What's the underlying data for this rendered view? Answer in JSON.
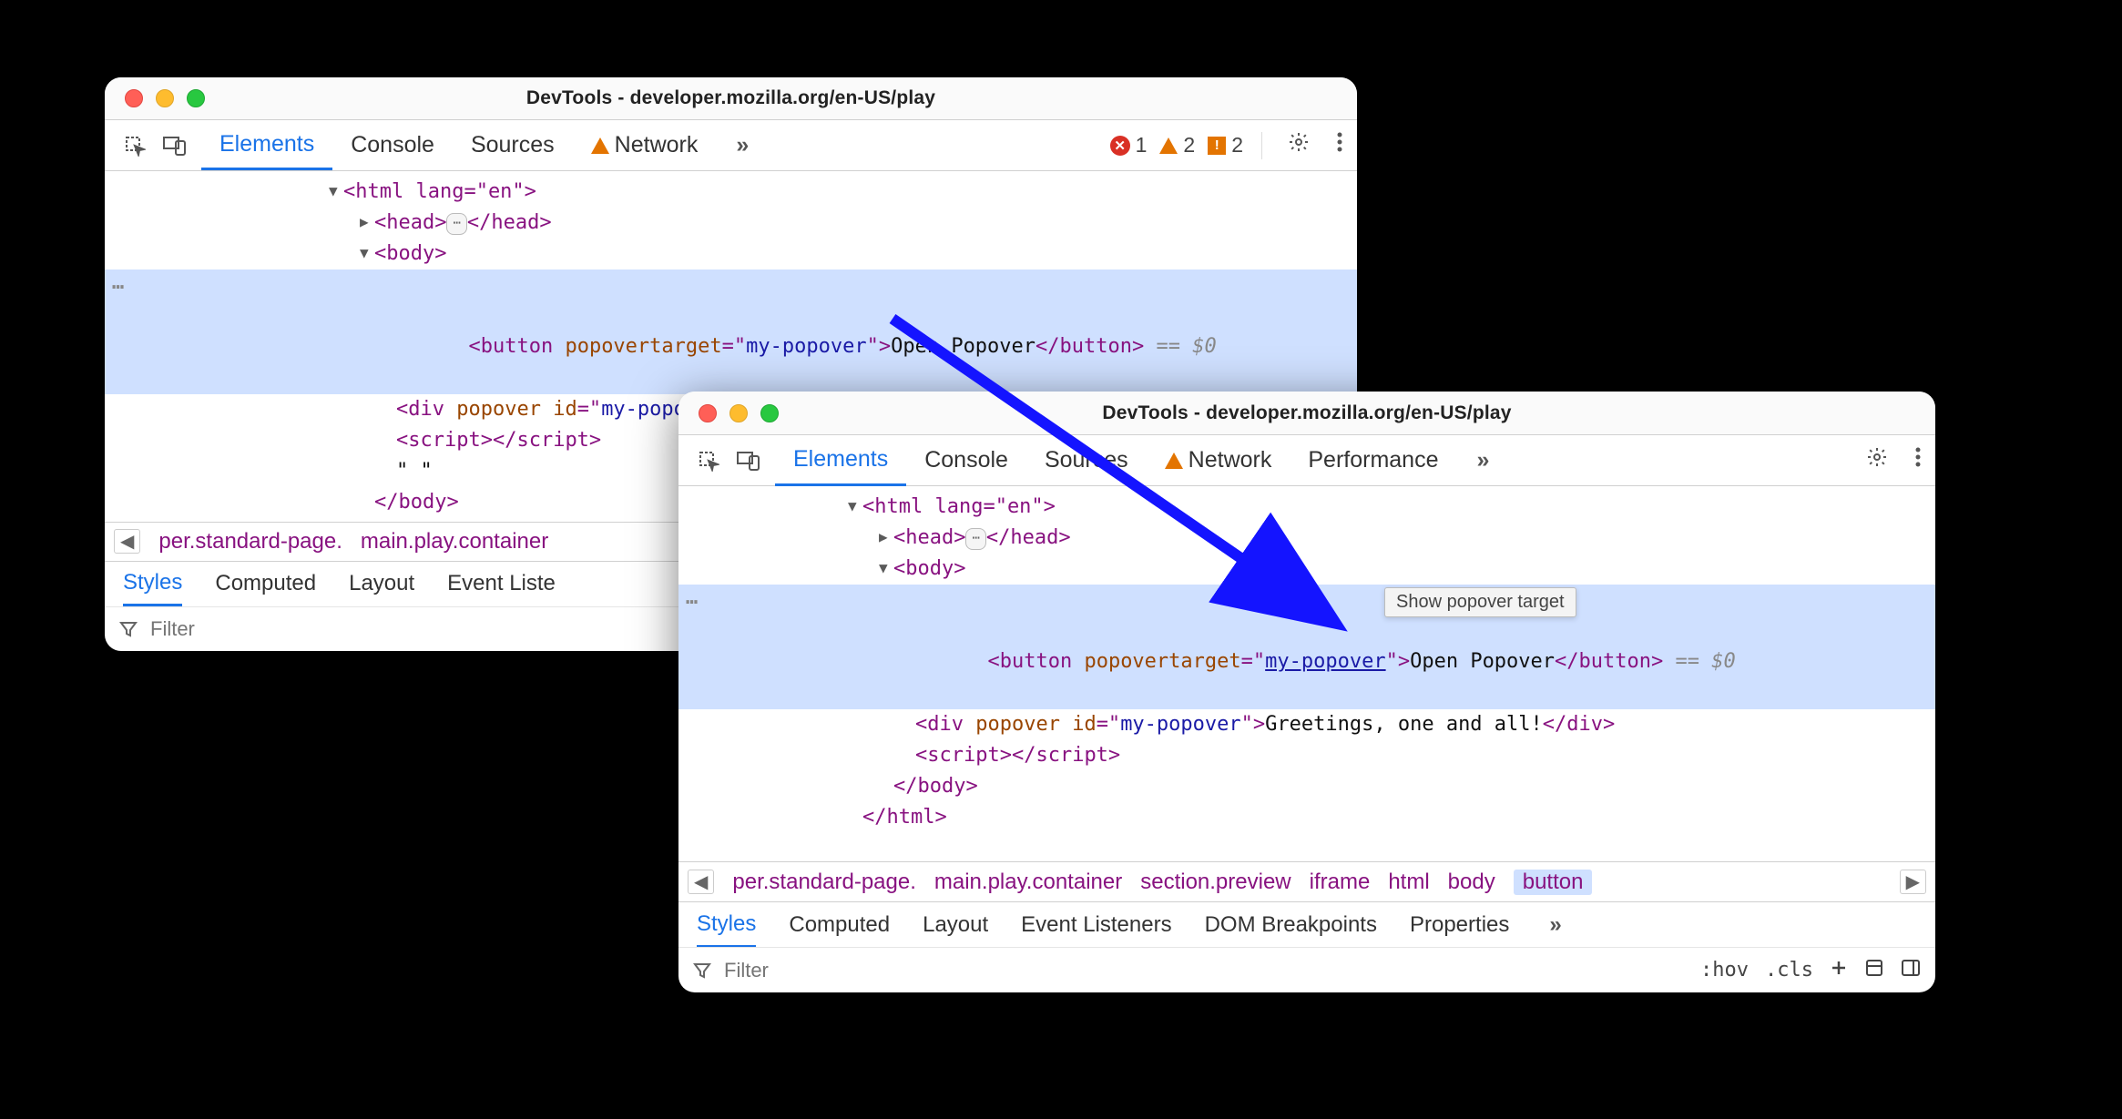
{
  "title": "DevTools - developer.mozilla.org/en-US/play",
  "tabs": {
    "elements": "Elements",
    "console": "Console",
    "sources": "Sources",
    "network": "Network",
    "performance": "Performance"
  },
  "counts": {
    "errors": "1",
    "warnings": "2",
    "issues": "2"
  },
  "dom": {
    "html_open": "<html lang=\"en\">",
    "head_open": "<head>",
    "head_close": "</head>",
    "body_open": "<body>",
    "button_open_a": "<button popovertarget=\"",
    "button_attrval": "my-popover",
    "button_open_b": "\">",
    "button_text": "Open Popover",
    "button_close": "</button>",
    "eq0": " == $0",
    "div_line_a": "<div popover id=\"",
    "div_id": "my-popover",
    "div_line_b": "\">",
    "div_text": "Greetings, one and all!",
    "div_close": "</div>",
    "script_open": "<script>",
    "script_close": "</script>",
    "blank": "\" \"",
    "body_close": "</body>",
    "html_close": "</html>"
  },
  "crumbs": {
    "frag0": "per.standard-page.",
    "frag1": "main.play.container",
    "section": "section.preview",
    "iframe": "iframe",
    "html": "html",
    "body": "body",
    "button": "button"
  },
  "subtabs": {
    "styles": "Styles",
    "computed": "Computed",
    "layout": "Layout",
    "event": "Event Listeners",
    "event_short": "Event Liste",
    "dom_bp": "DOM Breakpoints",
    "properties": "Properties"
  },
  "filter_placeholder": "Filter",
  "hov": ":hov",
  "cls": ".cls",
  "tooltip": "Show popover target"
}
